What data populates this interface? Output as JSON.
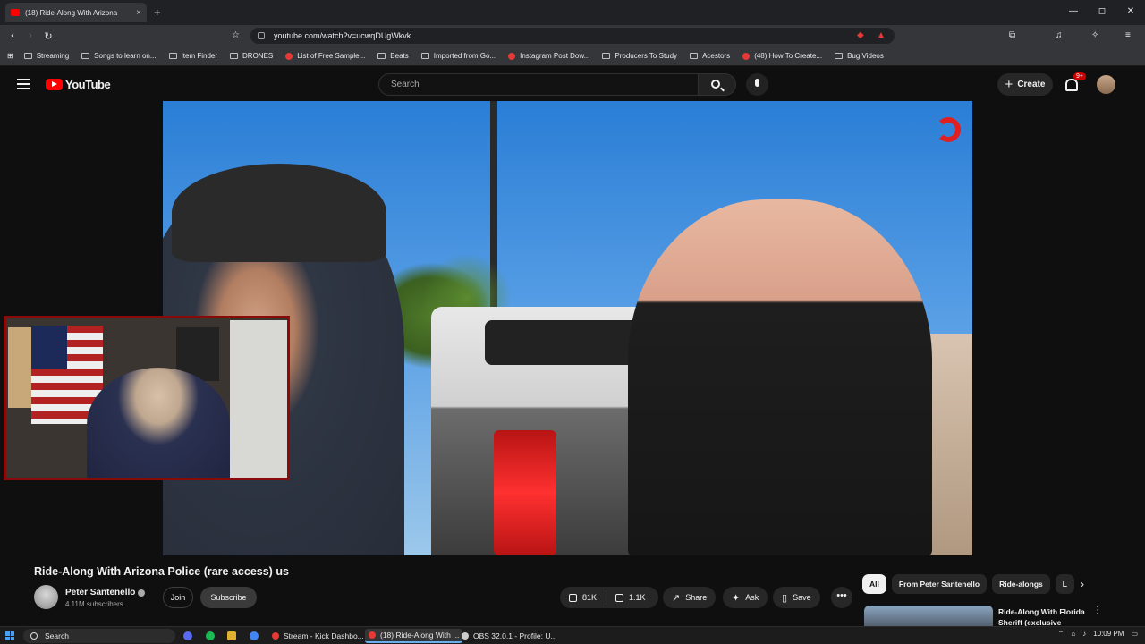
{
  "browser": {
    "tab_title": "(18) Ride-Along With Arizona",
    "tab_close": "×",
    "new_tab": "+",
    "window_controls": {
      "minimize": "—",
      "maximize": "◻",
      "close": "✕"
    },
    "nav": {
      "back": "‹",
      "forward": "›",
      "reload": "↻"
    },
    "url": "youtube.com/watch?v=ucwqDUgWkvk",
    "bookmarks": [
      {
        "label": "Streaming",
        "icon": "folder-icon"
      },
      {
        "label": "Songs to learn on...",
        "icon": "folder-icon"
      },
      {
        "label": "Item Finder",
        "icon": "folder-icon"
      },
      {
        "label": "DRONES",
        "icon": "folder-icon"
      },
      {
        "label": "List of Free Sample...",
        "icon": "site-icon"
      },
      {
        "label": "Beats",
        "icon": "folder-icon"
      },
      {
        "label": "Imported from Go...",
        "icon": "folder-icon"
      },
      {
        "label": "Instagram Post Dow...",
        "icon": "site-icon"
      },
      {
        "label": "Producers To Study",
        "icon": "folder-icon"
      },
      {
        "label": "Acestors",
        "icon": "folder-icon"
      },
      {
        "label": "(48) How To Create...",
        "icon": "youtube-icon"
      },
      {
        "label": "Bug Videos",
        "icon": "folder-icon"
      }
    ]
  },
  "youtube": {
    "logo_text": "YouTube",
    "search_placeholder": "Search",
    "create_label": "Create",
    "notification_badge": "9+",
    "accent_color": "#ff0000"
  },
  "video": {
    "title": "Ride-Along With Arizona Police (rare access) us",
    "channel_name": "Peter Santenello",
    "subscribers": "4.11M subscribers",
    "join_label": "Join",
    "subscribe_label": "Subscribe",
    "likes": "81K",
    "dislikes": "1.1K",
    "share_label": "Share",
    "ask_label": "Ask",
    "save_label": "Save",
    "more_label": "•••"
  },
  "sidebar": {
    "chips": [
      "All",
      "From Peter Santenello",
      "Ride-alongs",
      "L"
    ],
    "chip_arrow": "›",
    "recommendation_title": "Ride-Along With Florida Sheriff (exclusive",
    "recommendation_more": "⋮"
  },
  "taskbar": {
    "search_label": "Search",
    "apps": [
      {
        "label": "Stream - Kick Dashbo...",
        "color": "#e53935"
      },
      {
        "label": "(18) Ride-Along With ...",
        "color": "#e53935"
      },
      {
        "label": "OBS 32.0.1 - Profile: U...",
        "color": "#cccccc"
      }
    ],
    "clock": "10:09 PM"
  }
}
